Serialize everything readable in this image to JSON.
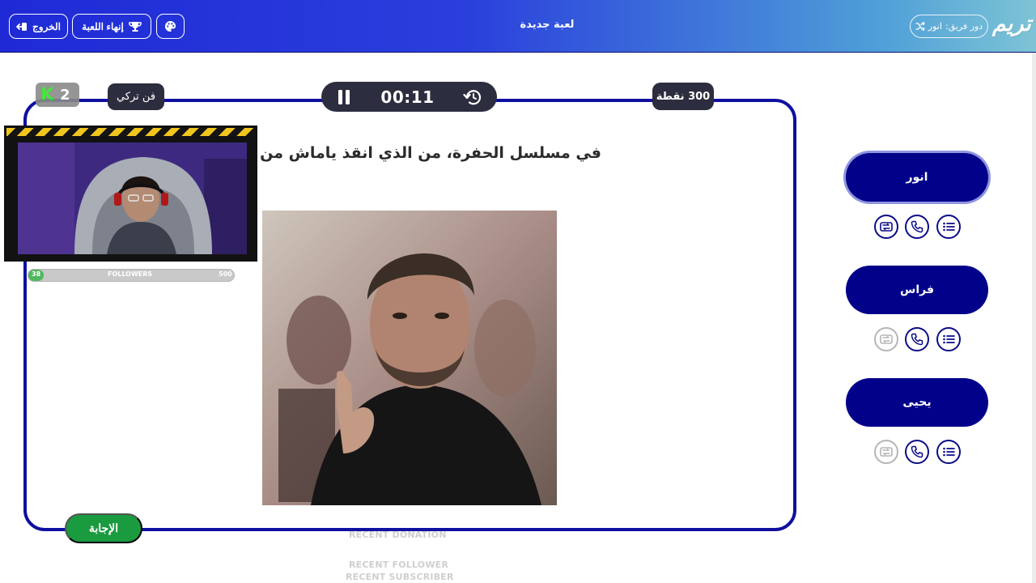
{
  "header": {
    "logo": "تريم",
    "turn_label": "دور فريق:",
    "turn_team": "انور",
    "title": "لعبة جديدة",
    "exit_label": "الخروج",
    "end_game_label": "إنهاء اللعبة"
  },
  "game": {
    "timer": "00:11",
    "points": "300 نقطة",
    "category": "فن تركي",
    "question": "في مسلسل الحفرة، من الذي انقذ ياماش من الموت؟",
    "answer_label": "الإجابة"
  },
  "overlay": {
    "k_count": "2",
    "followers": {
      "label": "FOLLOWERS",
      "current": "38",
      "goal": "500",
      "progress": 0.076
    },
    "recent_donation": "RECENT DONATION",
    "recent_follower": "RECENT FOLLOWER",
    "recent_subscriber": "RECENT SUBSCRIBER"
  },
  "players": [
    {
      "name": "انور",
      "active": true,
      "lifelines": [
        {
          "icon": "swap-icon",
          "used": false
        },
        {
          "icon": "phone-icon",
          "used": false
        },
        {
          "icon": "list-icon",
          "used": false
        }
      ]
    },
    {
      "name": "فراس",
      "active": false,
      "lifelines": [
        {
          "icon": "swap-icon",
          "used": true
        },
        {
          "icon": "phone-icon",
          "used": false
        },
        {
          "icon": "list-icon",
          "used": false
        }
      ]
    },
    {
      "name": "يحيى",
      "active": false,
      "lifelines": [
        {
          "icon": "swap-icon",
          "used": true
        },
        {
          "icon": "phone-icon",
          "used": false
        },
        {
          "icon": "list-icon",
          "used": false
        }
      ]
    }
  ],
  "colors": {
    "header_start": "#1f2ad6",
    "header_end": "#7ec4d6",
    "card_border": "#0f0fa0",
    "player_bg": "#01018a",
    "answer_green": "#1a9b3f",
    "pill_dark": "#2c2d3e"
  }
}
